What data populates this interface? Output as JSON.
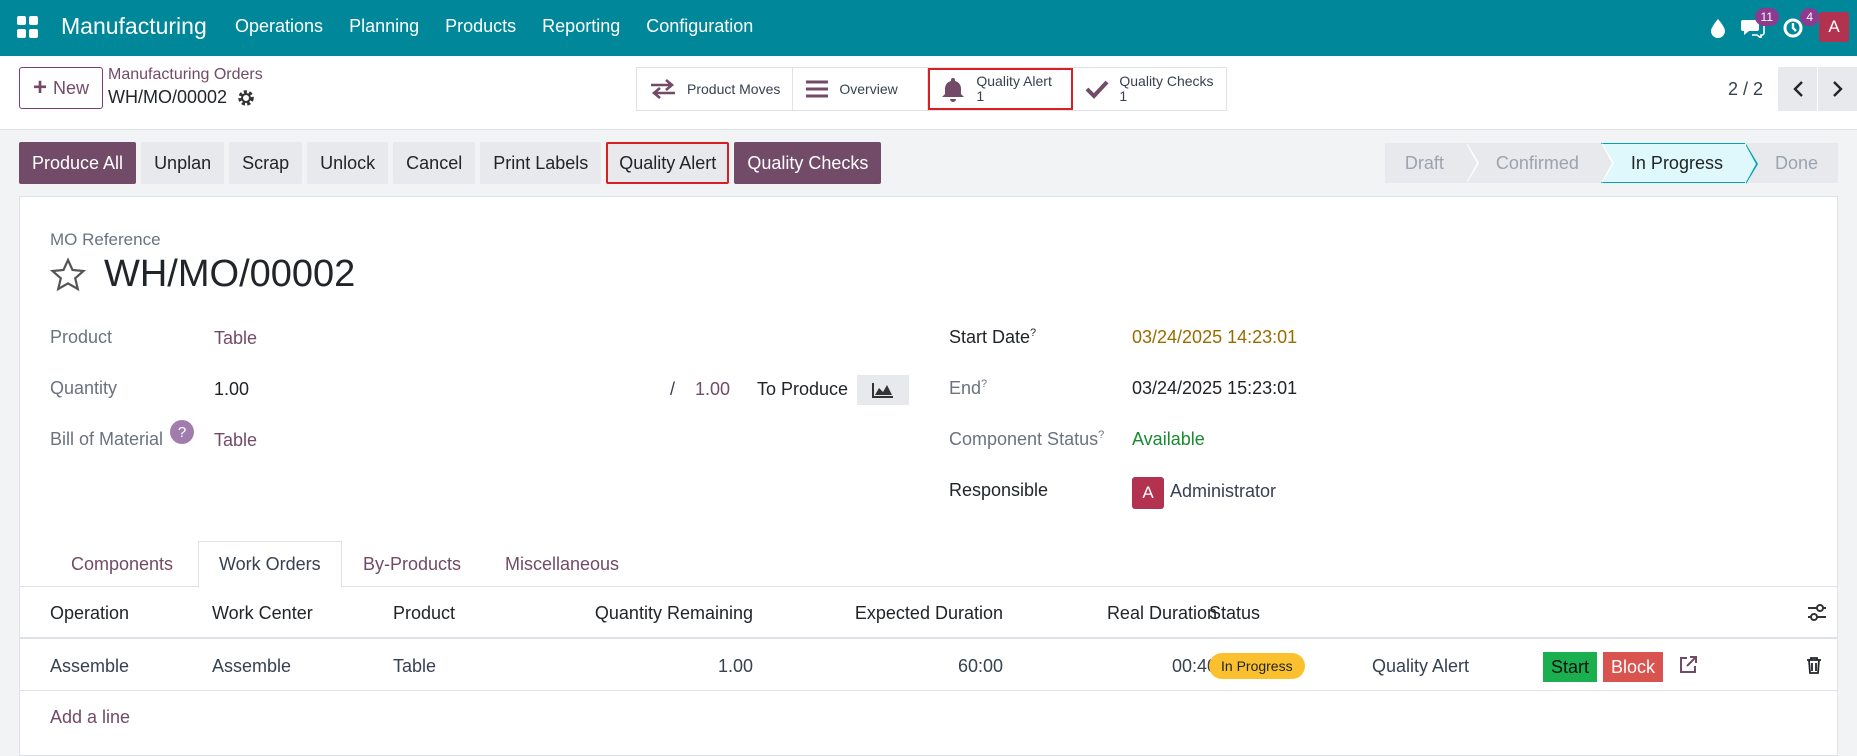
{
  "navbar": {
    "app_name": "Manufacturing",
    "menu": [
      "Operations",
      "Planning",
      "Products",
      "Reporting",
      "Configuration"
    ],
    "messages_count": "11",
    "activities_count": "4",
    "user_initial": "A"
  },
  "control": {
    "new_label": "New",
    "breadcrumb_parent": "Manufacturing Orders",
    "breadcrumb_current": "WH/MO/00002",
    "smart_buttons": {
      "product_moves": "Product Moves",
      "overview": "Overview",
      "quality_alert": "Quality Alert",
      "quality_alert_count": "1",
      "quality_checks": "Quality Checks",
      "quality_checks_count": "1"
    },
    "pager": "2 / 2"
  },
  "actions": [
    "Produce All",
    "Unplan",
    "Scrap",
    "Unlock",
    "Cancel",
    "Print Labels",
    "Quality Alert",
    "Quality Checks"
  ],
  "stages": [
    "Draft",
    "Confirmed",
    "In Progress",
    "Done"
  ],
  "form": {
    "ref_label": "MO Reference",
    "ref_value": "WH/MO/00002",
    "product_label": "Product",
    "product_value": "Table",
    "quantity_label": "Quantity",
    "quantity_value": "1.00",
    "quantity_slash": "/",
    "quantity_total": "1.00",
    "to_produce": "To Produce",
    "bom_label": "Bill of Material",
    "bom_help": "?",
    "bom_value": "Table",
    "start_label": "Start Date",
    "start_value": "03/24/2025 14:23:01",
    "end_label": "End",
    "end_value": "03/24/2025 15:23:01",
    "component_status_label": "Component Status",
    "component_status_value": "Available",
    "responsible_label": "Responsible",
    "responsible_initial": "A",
    "responsible_value": "Administrator",
    "help_mark": "?"
  },
  "tabs": [
    "Components",
    "Work Orders",
    "By-Products",
    "Miscellaneous"
  ],
  "table": {
    "headers": [
      "Operation",
      "Work Center",
      "Product",
      "Quantity Remaining",
      "Expected Duration",
      "Real Duration",
      "Status"
    ],
    "row": {
      "operation": "Assemble",
      "work_center": "Assemble",
      "product": "Table",
      "qty_remaining": "1.00",
      "expected": "60:00",
      "real": "00:40",
      "status": "In Progress",
      "quality_alert": "Quality Alert",
      "start": "Start",
      "block": "Block"
    },
    "add_line": "Add a line"
  },
  "colors": {
    "navbar": "#00889a",
    "primary": "#714b67",
    "highlight": "#d62024",
    "status_pill": "#fbc02d",
    "start": "#1ab04f",
    "block": "#d9534f"
  }
}
